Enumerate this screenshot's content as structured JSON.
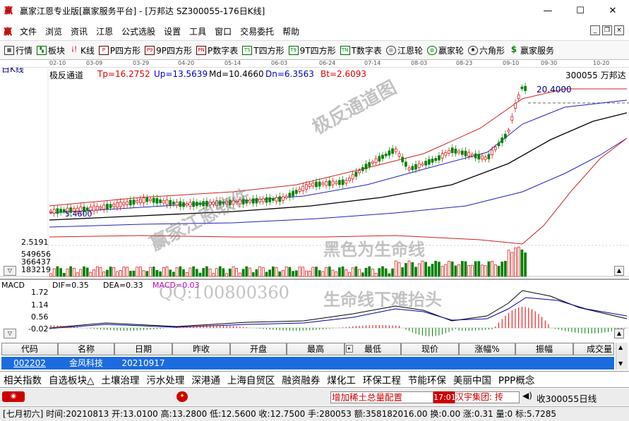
{
  "window": {
    "title": "赢家江恩专业版[赢家服务平台] - [万邦达  SZ300055-176日K线]",
    "app_icon": "赢",
    "minimize": "—",
    "maximize": "☐",
    "close": "✕"
  },
  "menu": [
    "文件",
    "浏览",
    "资讯",
    "江恩",
    "公式选股",
    "设置",
    "工具",
    "窗口",
    "交易委托",
    "帮助"
  ],
  "menu_icon": "赢",
  "mdi_buttons": [
    "_",
    "❐",
    "×"
  ],
  "toolbar": [
    {
      "label": "行情",
      "icon": "grid"
    },
    {
      "label": "板块",
      "icon": "blocks"
    },
    {
      "label": "K线",
      "icon": "kline"
    },
    {
      "label": "P四方形",
      "icon": "P"
    },
    {
      "label": "9P四方形",
      "icon": "P9"
    },
    {
      "label": "P数字表",
      "icon": "PN"
    },
    {
      "label": "T四方形",
      "icon": "TS"
    },
    {
      "label": "9T四方形",
      "icon": "T9"
    },
    {
      "label": "T数字表",
      "icon": "TN"
    },
    {
      "label": "江恩轮",
      "icon": "wheel"
    },
    {
      "label": "赢家轮",
      "icon": "wheel2"
    },
    {
      "label": "六角形",
      "icon": "hex"
    },
    {
      "label": "赢家服务",
      "icon": "dollar"
    }
  ],
  "chart": {
    "period_label": "日K线",
    "dates": [
      "02-10",
      "03-09",
      "03-29",
      "04-20",
      "05-14",
      "06-03",
      "06-24",
      "07-14",
      "08-03",
      "08-23",
      "09-10",
      "09-30",
      "10-20"
    ],
    "indicator": {
      "name": "极反通道",
      "Tp": "Tp=16.2752",
      "Up": "Up=13.5639",
      "Md": "Md=10.4660",
      "Dn": "Dn=6.3563",
      "Bt": "Bt=2.6093"
    },
    "stock": "300055  万邦达",
    "high_label": "20.4000",
    "low_label": "5.4600",
    "price_axis_bottom": "2.5191",
    "vol_axis": [
      "549656",
      "366437",
      "183219"
    ],
    "macd": {
      "name": "MACD",
      "dif": "DIF=0.35",
      "dea": "DEA=0.33",
      "macd": "MACD=0.03",
      "axis": [
        "1.72",
        "1.14",
        "0.56",
        "-0.02"
      ]
    },
    "watermarks": [
      "极反通道图",
      "赢家江恩软件",
      "黑色为生命线",
      "QQ:100800360",
      "生命线下难抬头"
    ]
  },
  "table": {
    "headers": [
      "代码",
      "名称",
      "日期",
      "昨收",
      "开盘",
      "最高",
      "最低",
      "现价",
      "涨幅%",
      "振幅",
      "成交量"
    ],
    "row": {
      "code": "002202",
      "name": "金风科技",
      "date": "20210917"
    }
  },
  "tabs": [
    "相关指数",
    "自选板块△",
    "土壤治理",
    "污水处理",
    "深港通",
    "上海自贸区",
    "融资融券",
    "煤化工",
    "环保工程",
    "节能环保",
    "美丽中国",
    "PPP概念"
  ],
  "ticker": {
    "news1": "增加稀土总量配置",
    "time": "17:01",
    "news2": "汉宇集团: 抟",
    "right": "收300055日线"
  },
  "status": "[七月初六] 时间:20210813 开:13.0100 高:13.2800 低:12.5600 收:12.7500 手:280053 额:358182016.00 换:0.00 涨:0.31 量:0 标:5.7285"
}
